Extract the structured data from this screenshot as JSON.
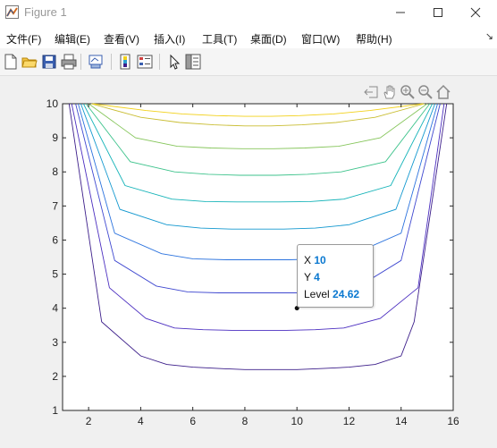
{
  "window": {
    "title": "Figure 1"
  },
  "menu": [
    {
      "label": "文件(F)"
    },
    {
      "label": "编辑(E)"
    },
    {
      "label": "查看(V)"
    },
    {
      "label": "插入(I)"
    },
    {
      "label": "工具(T)"
    },
    {
      "label": "桌面(D)"
    },
    {
      "label": "窗口(W)"
    },
    {
      "label": "帮助(H)"
    }
  ],
  "menu_overflow_icon": "arrow-overflow-icon",
  "toolbar_icons": [
    "new-figure-icon",
    "open-file-icon",
    "save-icon",
    "print-icon",
    "link-plot-icon",
    "insert-colorbar-icon",
    "insert-legend-icon",
    "edit-plot-icon",
    "property-inspector-icon"
  ],
  "axes_toolbar_icons": [
    "export-icon",
    "pan-hand-icon",
    "zoom-in-icon",
    "zoom-out-icon",
    "restore-view-icon"
  ],
  "colors": {
    "contour_levels": [
      "#3c1e8a",
      "#4b2ec0",
      "#3f48d0",
      "#2c73de",
      "#1398cf",
      "#14b3b8",
      "#3ec38c",
      "#85c55a",
      "#c9bd32",
      "#f2d11a"
    ]
  },
  "chart_data": {
    "type": "contour",
    "title": "",
    "xlabel": "",
    "ylabel": "",
    "xlim": [
      1,
      16
    ],
    "ylim": [
      1,
      10
    ],
    "x_ticks": [
      "2",
      "4",
      "6",
      "8",
      "10",
      "12",
      "14",
      "16"
    ],
    "y_ticks": [
      "1",
      "2",
      "3",
      "4",
      "5",
      "6",
      "7",
      "8",
      "9",
      "10"
    ],
    "grid": false,
    "x": [
      1,
      2,
      3,
      4,
      5,
      6,
      7,
      8,
      9,
      10,
      11,
      12,
      13,
      14,
      15,
      16
    ],
    "contours": [
      {
        "level_index": 0,
        "y": [
          10,
          3.6,
          2.6,
          2.35,
          2.27,
          2.23,
          2.2,
          2.2,
          2.2,
          2.23,
          2.27,
          2.35,
          2.6,
          3.6,
          10
        ]
      },
      {
        "level_index": 1,
        "y": [
          10,
          4.6,
          3.7,
          3.42,
          3.37,
          3.35,
          3.35,
          3.35,
          3.37,
          3.42,
          3.7,
          4.6,
          10
        ]
      },
      {
        "level_index": 2,
        "y": [
          10,
          5.4,
          4.65,
          4.48,
          4.45,
          4.45,
          4.45,
          4.45,
          4.48,
          4.65,
          5.4,
          10
        ]
      },
      {
        "level_index": 3,
        "y": [
          10,
          6.2,
          5.6,
          5.45,
          5.42,
          5.42,
          5.42,
          5.45,
          5.6,
          6.2,
          10
        ]
      },
      {
        "level_index": 4,
        "y": [
          10,
          6.9,
          6.45,
          6.35,
          6.32,
          6.32,
          6.32,
          6.35,
          6.45,
          6.9,
          10
        ]
      },
      {
        "level_index": 5,
        "y": [
          10,
          7.6,
          7.2,
          7.13,
          7.12,
          7.12,
          7.12,
          7.13,
          7.2,
          7.6,
          10
        ]
      },
      {
        "level_index": 6,
        "y": [
          10,
          8.3,
          8.0,
          7.93,
          7.9,
          7.9,
          7.9,
          7.93,
          8.0,
          8.3,
          10
        ]
      },
      {
        "level_index": 7,
        "y": [
          10,
          9.0,
          8.75,
          8.7,
          8.68,
          8.68,
          8.68,
          8.7,
          8.75,
          9.0,
          10
        ]
      },
      {
        "level_index": 8,
        "y": [
          10,
          9.6,
          9.45,
          9.38,
          9.35,
          9.35,
          9.35,
          9.38,
          9.45,
          9.6,
          10
        ]
      },
      {
        "level_index": 9,
        "y": [
          10,
          9.8,
          9.7,
          9.65,
          9.63,
          9.63,
          9.63,
          9.65,
          9.7,
          9.8,
          10
        ]
      }
    ],
    "contour_x": [
      [
        1.25,
        2.5,
        4,
        5,
        6,
        7,
        8,
        9,
        10,
        11,
        12,
        13,
        14,
        14.5,
        15.75
      ],
      [
        1.35,
        2.8,
        4.2,
        5.3,
        6.4,
        7.5,
        8.5,
        9.6,
        10.7,
        11.8,
        13.2,
        14.65,
        15.65
      ],
      [
        1.5,
        3.0,
        4.6,
        5.8,
        7,
        8,
        9,
        10,
        11.2,
        12.4,
        14,
        15.5
      ],
      [
        1.6,
        3.0,
        4.8,
        6,
        7.3,
        8.5,
        9.7,
        11,
        12.2,
        14,
        15.4
      ],
      [
        1.7,
        3.2,
        5,
        6.3,
        7.5,
        8.5,
        9.5,
        10.7,
        12,
        13.8,
        15.3
      ],
      [
        1.8,
        3.4,
        5.2,
        6.5,
        7.7,
        8.5,
        9.3,
        10.5,
        11.8,
        13.6,
        15.2
      ],
      [
        1.9,
        3.6,
        5.3,
        6.6,
        7.8,
        8.5,
        9.2,
        10.4,
        11.7,
        13.4,
        15.1
      ],
      [
        2.0,
        3.8,
        5.4,
        6.7,
        7.9,
        8.5,
        9.1,
        10.3,
        11.6,
        13.2,
        15.0
      ],
      [
        2.1,
        4.0,
        5.5,
        6.8,
        8,
        8.5,
        9,
        10.2,
        11.5,
        13,
        14.9
      ],
      [
        2.15,
        4.2,
        5.6,
        6.9,
        8,
        8.5,
        9,
        10.1,
        11.4,
        12.8,
        14.85
      ]
    ],
    "datatip": {
      "x_label": "X",
      "x_value": "10",
      "y_label": "Y",
      "y_value": "4",
      "level_label": "Level",
      "level_value": "24.62",
      "point": {
        "x": 10,
        "y": 4
      }
    }
  }
}
